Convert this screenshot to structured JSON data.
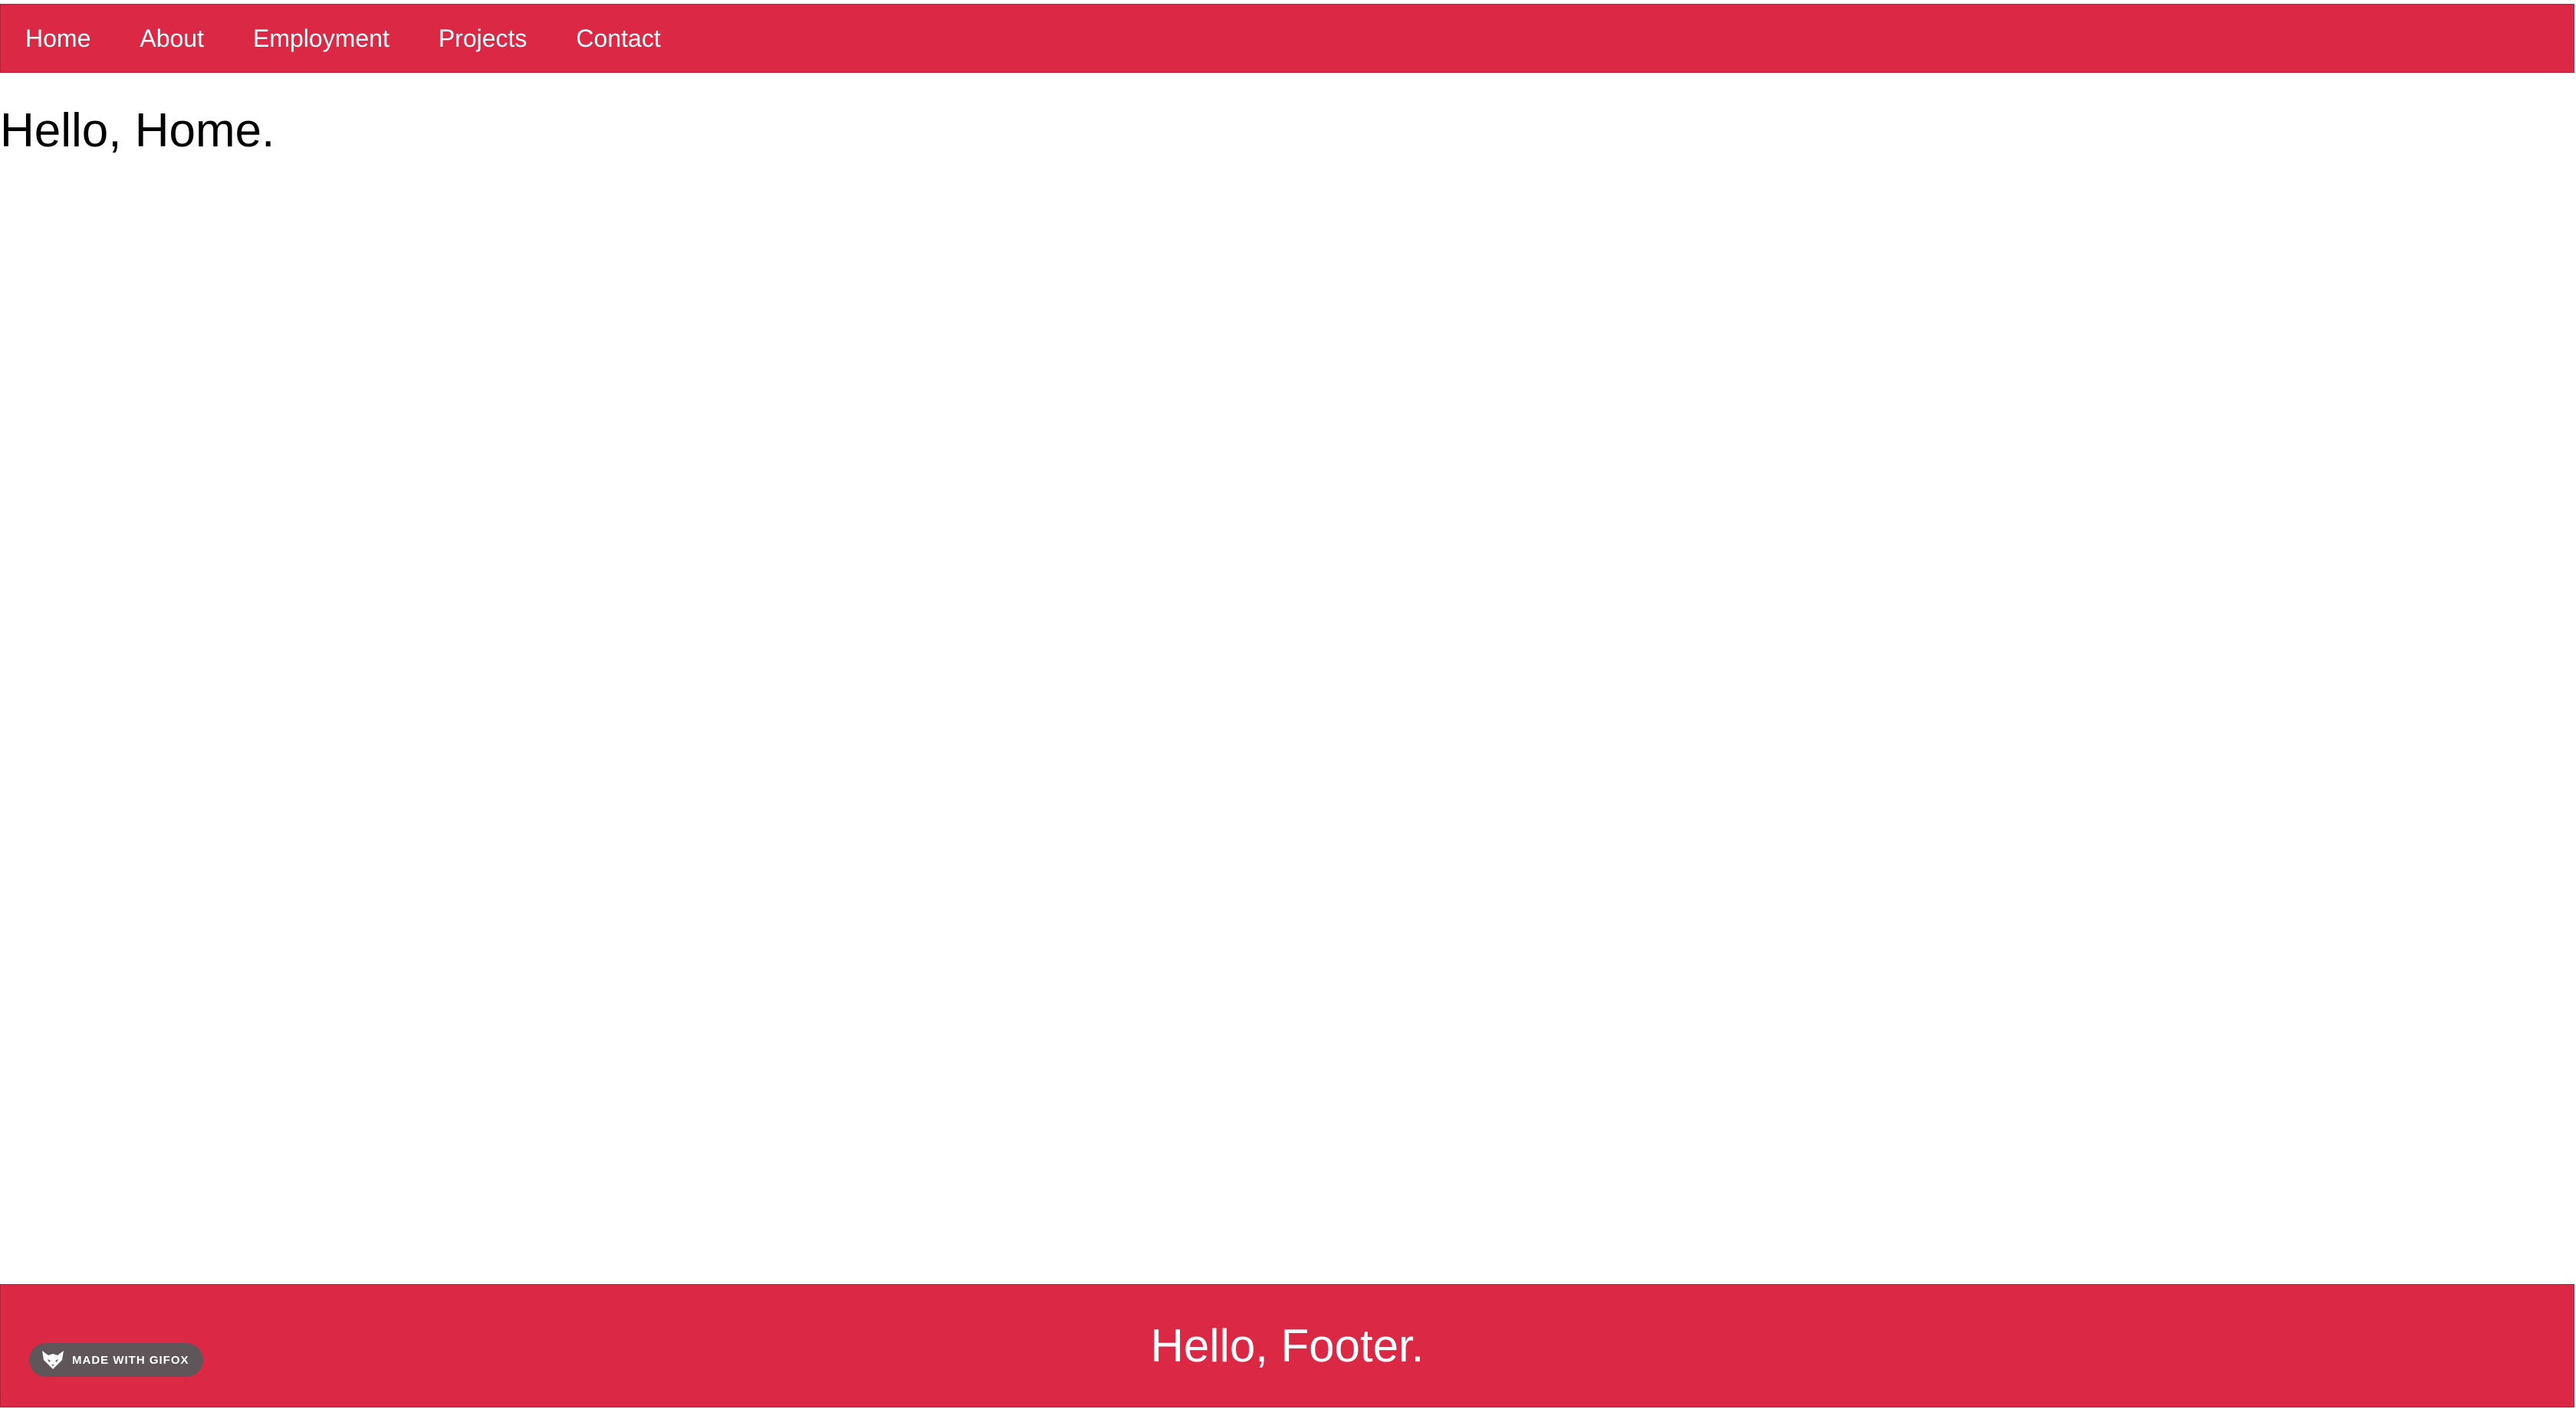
{
  "nav": {
    "items": [
      {
        "label": "Home"
      },
      {
        "label": "About"
      },
      {
        "label": "Employment"
      },
      {
        "label": "Projects"
      },
      {
        "label": "Contact"
      }
    ]
  },
  "main": {
    "heading": "Hello, Home."
  },
  "footer": {
    "text": "Hello, Footer."
  },
  "badge": {
    "label": "MADE WITH GIFOX",
    "icon": "fox-icon"
  },
  "colors": {
    "accent": "#da2845",
    "background": "#ffffff",
    "badge": "#5e5658"
  }
}
